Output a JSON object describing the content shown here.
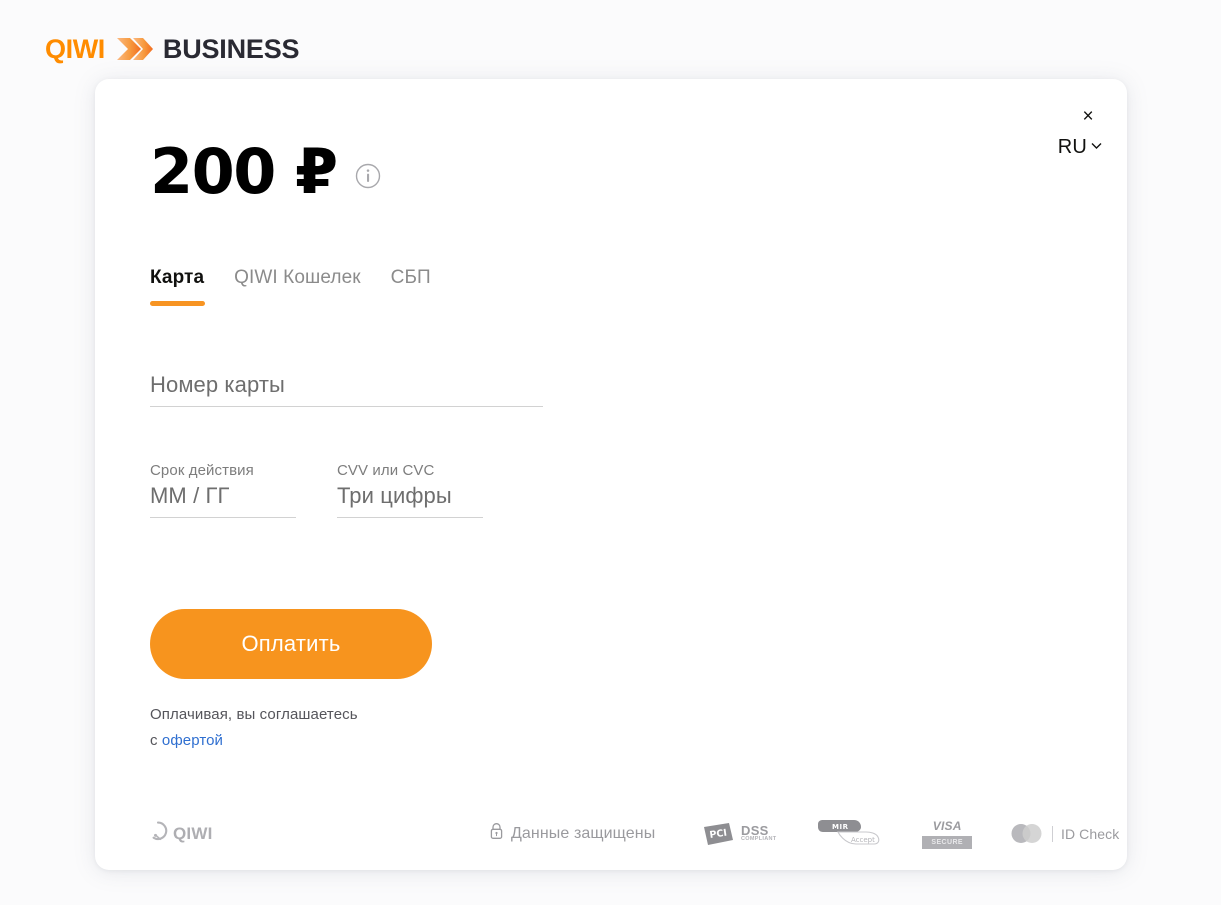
{
  "brand": {
    "qiwi": "QIWI",
    "business": "BUSINESS",
    "chevron_icon": "chevron-right-icon",
    "orange": "#f7941e"
  },
  "window_controls": {
    "close_label": "×",
    "close_icon": "close-icon",
    "language": "RU",
    "language_chevron_icon": "chevron-down-icon"
  },
  "amount": {
    "value": "200 ₽",
    "info_icon": "info-circle-icon"
  },
  "tabs": [
    {
      "label": "Карта",
      "active": true
    },
    {
      "label": "QIWI Кошелек",
      "active": false
    },
    {
      "label": "СБП",
      "active": false
    }
  ],
  "form": {
    "card_number": {
      "label": "",
      "placeholder": "Номер карты",
      "value": ""
    },
    "expiry": {
      "label": "Срок действия",
      "placeholder": "ММ / ГГ",
      "value": ""
    },
    "cvv": {
      "label": "CVV или CVC",
      "placeholder": "Три цифры",
      "value": ""
    },
    "submit_label": "Оплатить"
  },
  "offer": {
    "line1": "Оплачивая, вы соглашаетесь",
    "prefix": "с ",
    "link": "офертой",
    "link_color": "#2f6fd0"
  },
  "footer": {
    "qiwi_logo_text": "QIWI",
    "qiwi_logo_icon": "qiwi-q-icon",
    "secure_icon": "lock-icon",
    "secure_text": "Данные защищены",
    "badges": {
      "pci": {
        "mark": "PCI",
        "name": "DSS",
        "sub": "COMPLIANT"
      },
      "mir": {
        "name": "MIR",
        "sub": "Accept"
      },
      "visa": {
        "name": "VISA",
        "sub": "SECURE"
      },
      "idcheck": {
        "label": "ID Check",
        "icon": "mastercard-circles-icon"
      }
    }
  }
}
